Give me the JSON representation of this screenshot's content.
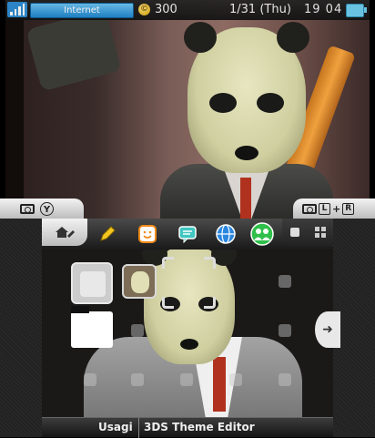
{
  "status_bar": {
    "network_label": "Internet",
    "coin_icon_label": "©",
    "coins": "300",
    "date": "1/31 (Thu)",
    "time": "19 04"
  },
  "top_tabs": {
    "left_button": "Y",
    "right_label_l": "L",
    "right_plus": "+",
    "right_label_r": "R"
  },
  "toolbar": {
    "icons": [
      "home-settings-icon",
      "pencil-icon",
      "smiley-icon",
      "chat-icon",
      "globe-icon",
      "friends-icon",
      "view-toggle-icon",
      "grid-icon"
    ]
  },
  "bottom_bar": {
    "user": "Usagi",
    "title": "3DS Theme Editor"
  },
  "colors": {
    "accent_blue": "#1d86cf",
    "coin_gold": "#d4a400",
    "tie_red": "#b0321e"
  }
}
